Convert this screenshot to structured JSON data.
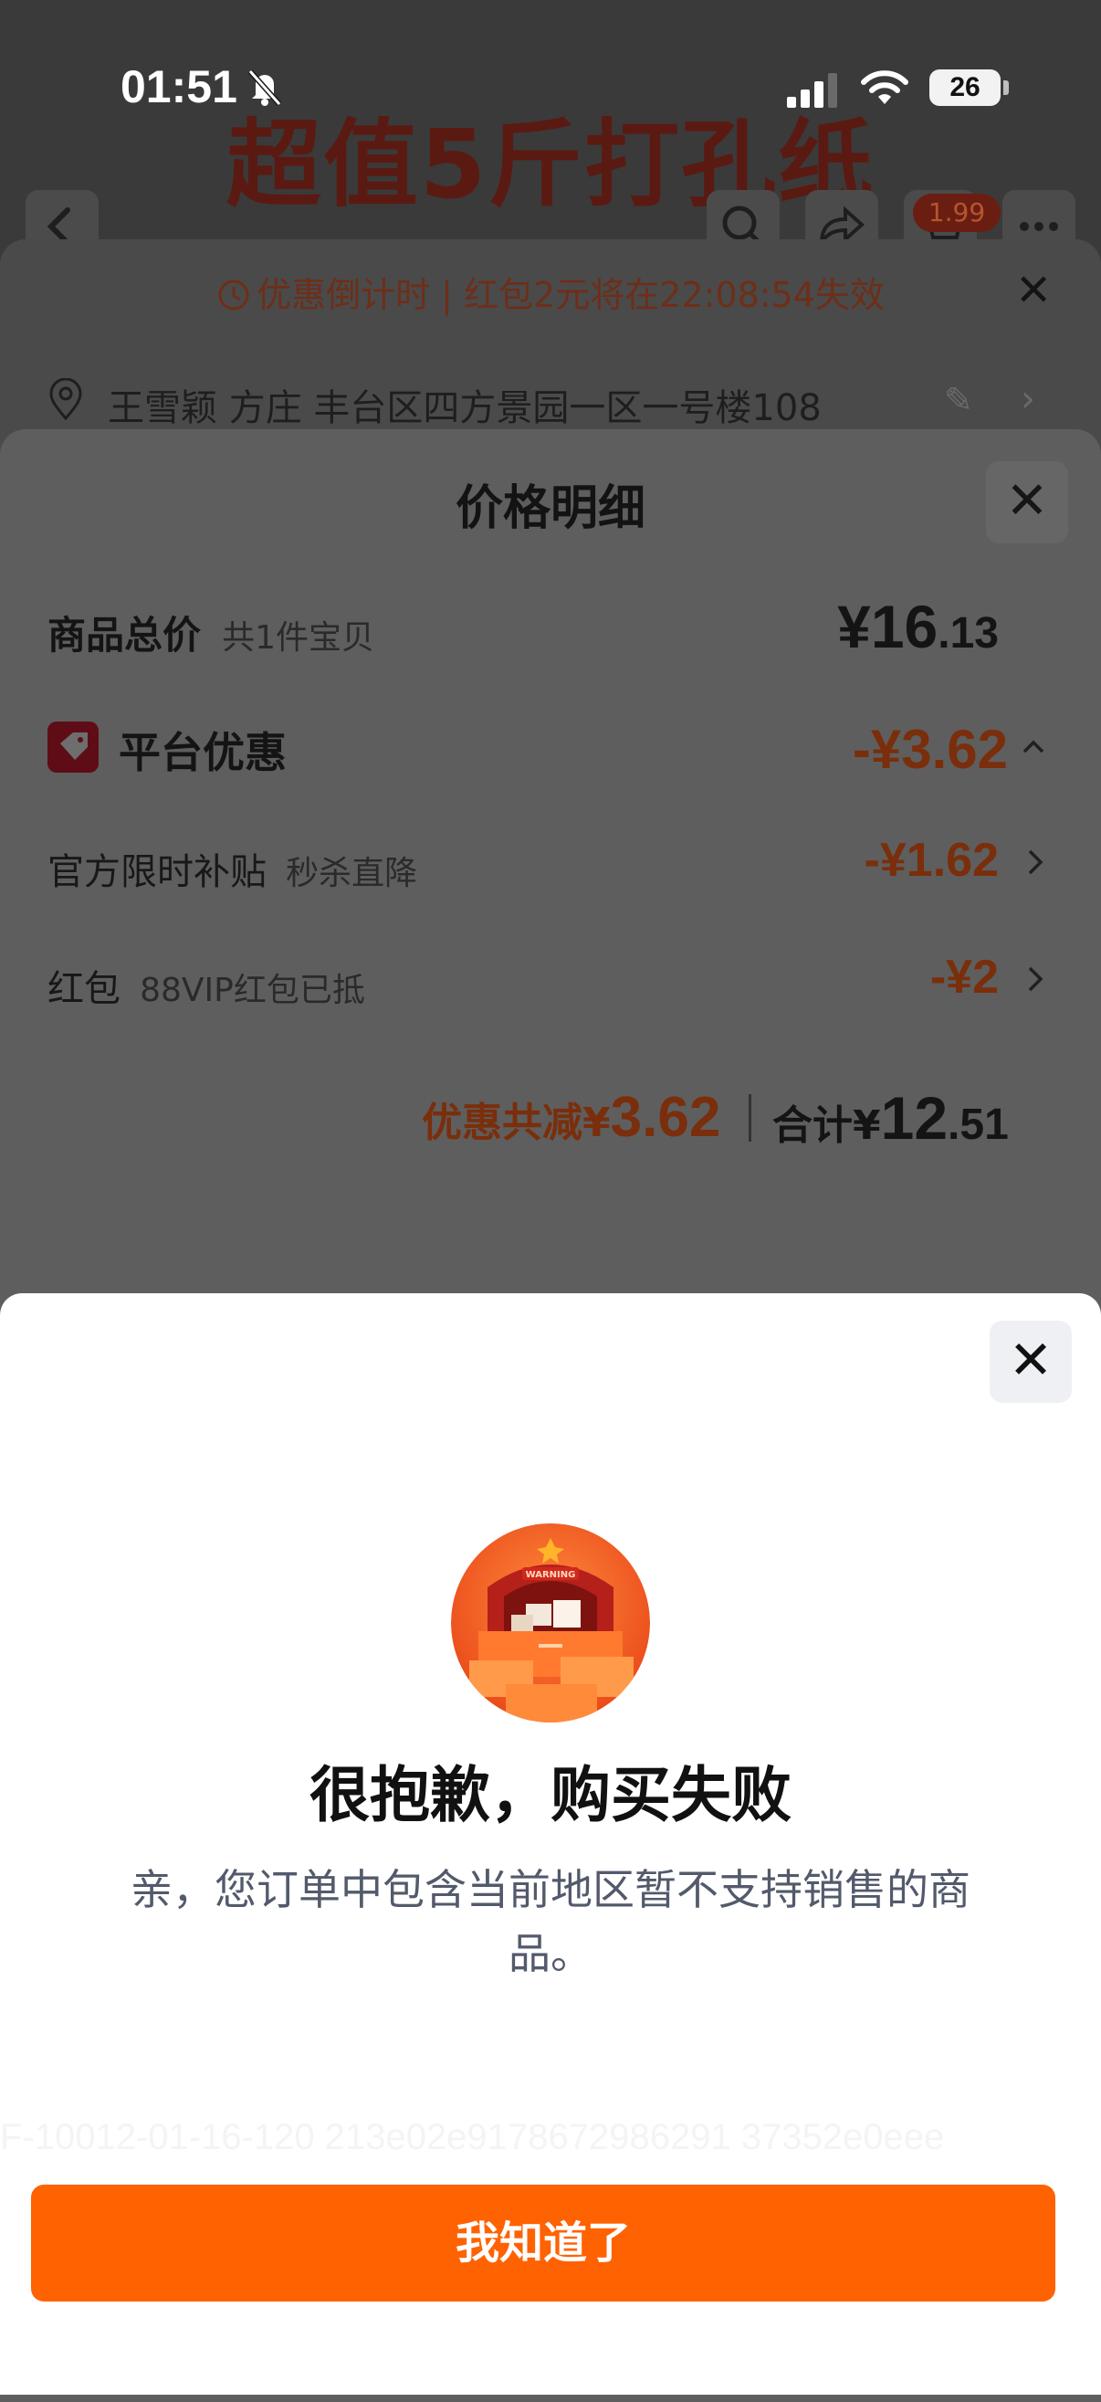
{
  "status_bar": {
    "time": "01:51",
    "battery": "26"
  },
  "background": {
    "product_title": "超值5斤打孔纸",
    "cart_badge": "1.99",
    "countdown": "优惠倒计时 | 红包2元将在22:08:54失效",
    "address": "王雪颖 方庄 丰台区四方景园一区一号楼108"
  },
  "price_detail": {
    "title": "价格明细",
    "goods_total_label": "商品总价",
    "goods_total_sub": "共1件宝贝",
    "goods_total_value_int": "¥16",
    "goods_total_value_dec": ".13",
    "platform_discount_label": "平台优惠",
    "platform_discount_value": "-¥3.62",
    "subsidy_label": "官方限时补贴",
    "subsidy_sub": "秒杀直降",
    "subsidy_value": "-¥1.62",
    "redpacket_label": "红包",
    "redpacket_sub": "88VIP红包已抵",
    "redpacket_value": "-¥2",
    "saved_prefix": "优惠共减¥",
    "saved_value": "3.62",
    "total_prefix": "合计¥",
    "total_int": "12",
    "total_dec": ".51"
  },
  "error_modal": {
    "illustration_text": "WARNING",
    "title": "很抱歉，购买失败",
    "description": "亲，您订单中包含当前地区暂不支持销售的商品。",
    "trace_id": "F-10012-01-16-120 213e02e9178672986291 37352e0eee",
    "confirm_button": "我知道了"
  },
  "colors": {
    "accent": "#ff6200",
    "modal_bg": "#ffffff",
    "title_text": "#111111",
    "desc_text": "#525a6b"
  },
  "icons": [
    "back-icon",
    "search-icon",
    "share-icon",
    "cart-icon",
    "more-icon",
    "clock-icon",
    "close-icon",
    "location-pin-icon",
    "edit-icon",
    "chevron-right-icon",
    "tag-icon",
    "chevron-up-icon",
    "warning-box-illustration",
    "signal-icon",
    "wifi-icon",
    "silent-bell-icon",
    "battery-icon"
  ]
}
